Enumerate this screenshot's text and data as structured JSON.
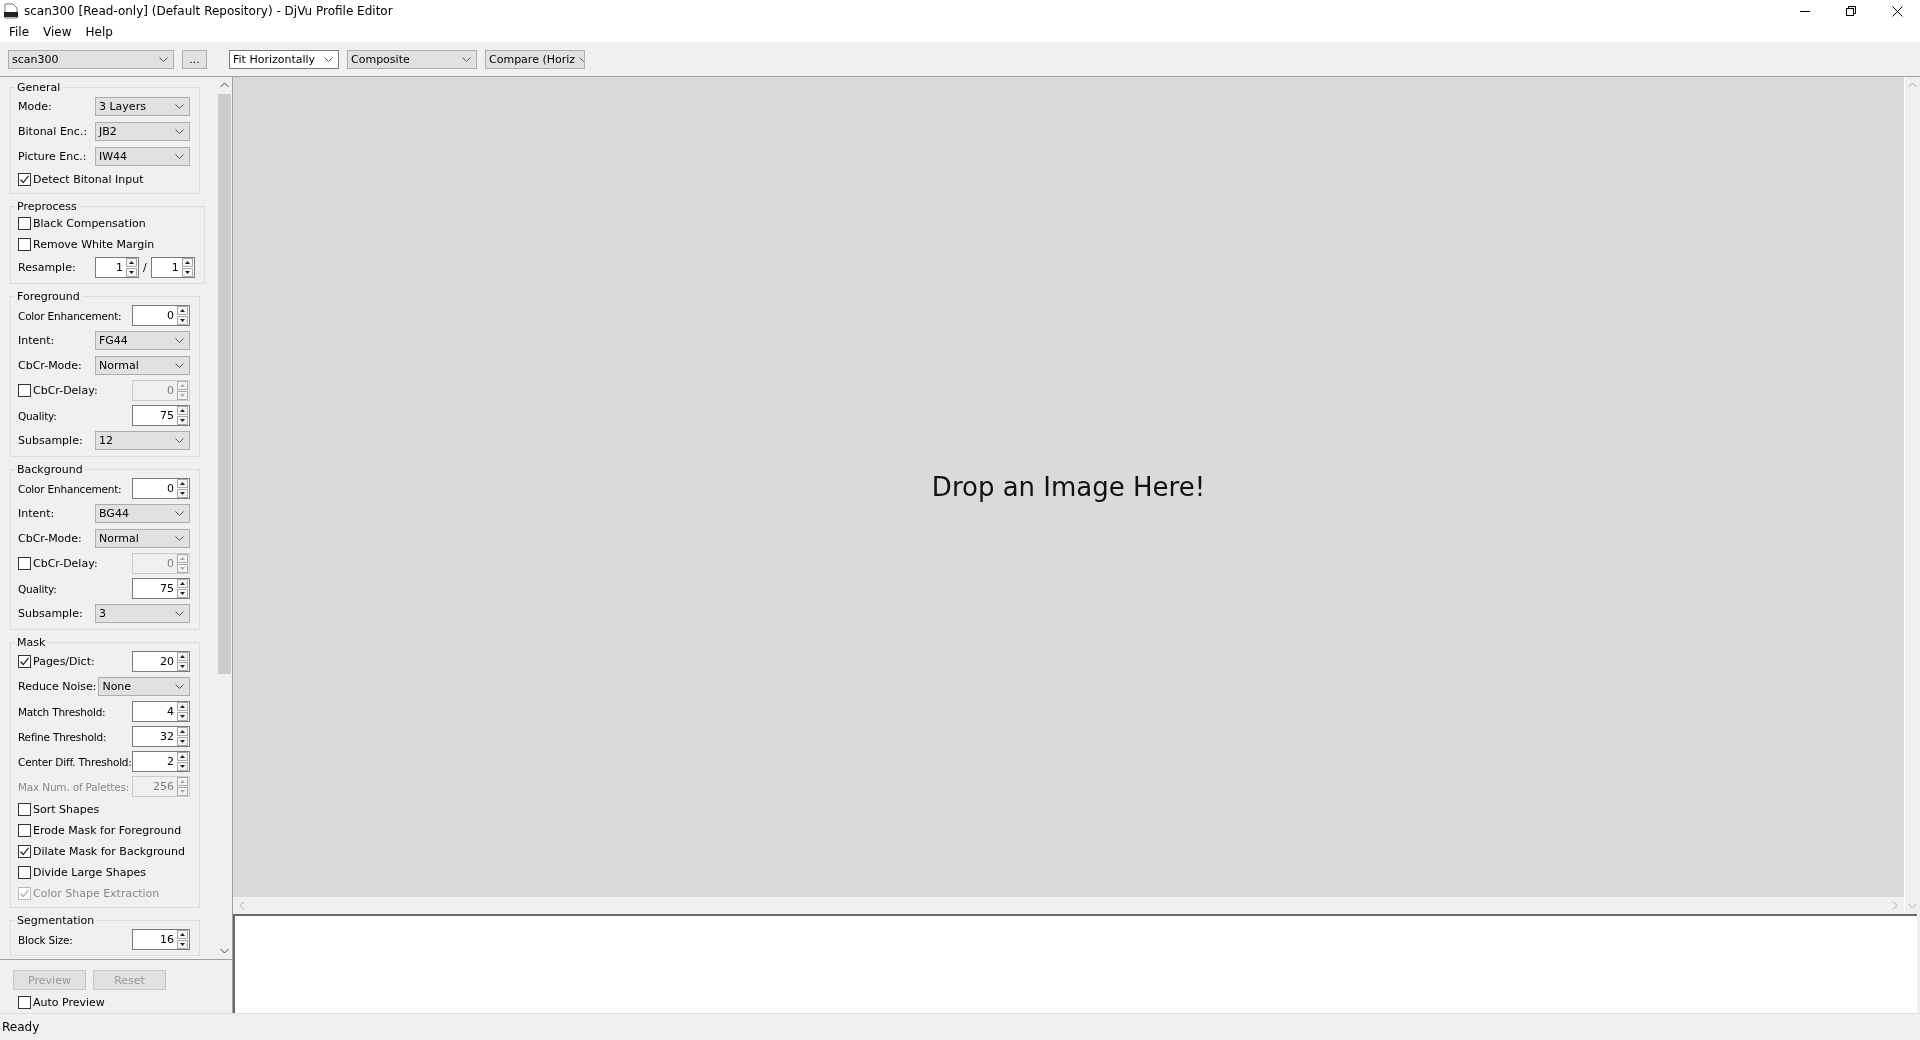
{
  "window": {
    "title": "scan300 [Read-only] (Default Repository) - DjVu Profile Editor"
  },
  "menu": [
    "File",
    "View",
    "Help"
  ],
  "toolbar": {
    "profile": "scan300",
    "browse": "...",
    "zoom": "Fit Horizontally",
    "display": "Composite",
    "compare": "Compare (Horiz"
  },
  "settings": [
    {
      "title": "General",
      "rows": [
        {
          "kind": "select",
          "label": "Mode:",
          "value": "3 Layers"
        },
        {
          "kind": "select",
          "label": "Bitonal Enc.:",
          "value": "JB2"
        },
        {
          "kind": "select",
          "label": "Picture Enc.:",
          "value": "IW44"
        },
        {
          "kind": "check",
          "label": "Detect Bitonal Input",
          "checked": true,
          "disabled": false
        }
      ]
    },
    {
      "title": "Preprocess",
      "rows": [
        {
          "kind": "check",
          "label": "Black Compensation",
          "checked": false,
          "disabled": false
        },
        {
          "kind": "check",
          "label": "Remove White Margin",
          "checked": false,
          "disabled": false
        },
        {
          "kind": "ratio",
          "label": "Resample:",
          "value": "1",
          "value2": "1",
          "separator": "/"
        }
      ]
    },
    {
      "title": "Foreground",
      "rows": [
        {
          "kind": "spin",
          "label": "Color Enhancement:",
          "value": "0",
          "disabled": false
        },
        {
          "kind": "select",
          "label": "Intent:",
          "value": "FG44"
        },
        {
          "kind": "select",
          "label": "CbCr-Mode:",
          "value": "Normal"
        },
        {
          "kind": "checkspin",
          "label": "CbCr-Delay:",
          "checked": false,
          "value": "0",
          "disabled": true
        },
        {
          "kind": "spin",
          "label": "Quality:",
          "value": "75",
          "disabled": false
        },
        {
          "kind": "select",
          "label": "Subsample:",
          "value": "12"
        }
      ]
    },
    {
      "title": "Background",
      "rows": [
        {
          "kind": "spin",
          "label": "Color Enhancement:",
          "value": "0",
          "disabled": false
        },
        {
          "kind": "select",
          "label": "Intent:",
          "value": "BG44"
        },
        {
          "kind": "select",
          "label": "CbCr-Mode:",
          "value": "Normal"
        },
        {
          "kind": "checkspin",
          "label": "CbCr-Delay:",
          "checked": false,
          "value": "0",
          "disabled": true
        },
        {
          "kind": "spin",
          "label": "Quality:",
          "value": "75",
          "disabled": false
        },
        {
          "kind": "select",
          "label": "Subsample:",
          "value": "3"
        }
      ]
    },
    {
      "title": "Mask",
      "rows": [
        {
          "kind": "checkspin",
          "label": "Pages/Dict:",
          "checked": true,
          "value": "20",
          "disabled": false
        },
        {
          "kind": "select",
          "label": "Reduce Noise:",
          "value": "None"
        },
        {
          "kind": "spin",
          "label": "Match Threshold:",
          "value": "4",
          "disabled": false
        },
        {
          "kind": "spin",
          "label": "Refine Threshold:",
          "value": "32",
          "disabled": false
        },
        {
          "kind": "spin",
          "label": "Center Diff. Threshold:",
          "value": "2",
          "disabled": false
        },
        {
          "kind": "spin",
          "label": "Max Num. of Palettes:",
          "value": "256",
          "disabled": true
        },
        {
          "kind": "check",
          "label": "Sort Shapes",
          "checked": false,
          "disabled": false
        },
        {
          "kind": "check",
          "label": "Erode Mask for Foreground",
          "checked": false,
          "disabled": false
        },
        {
          "kind": "check",
          "label": "Dilate Mask for Background",
          "checked": true,
          "disabled": false
        },
        {
          "kind": "check",
          "label": "Divide Large Shapes",
          "checked": false,
          "disabled": false
        },
        {
          "kind": "check",
          "label": "Color Shape Extraction",
          "checked": true,
          "disabled": true
        }
      ]
    },
    {
      "title": "Segmentation",
      "rows": [
        {
          "kind": "spin",
          "label": "Block Size:",
          "value": "16",
          "disabled": false
        }
      ]
    }
  ],
  "buttons": [
    {
      "label": "Preview",
      "disabled": true
    },
    {
      "label": "Reset",
      "disabled": true
    }
  ],
  "auto_preview": {
    "label": "Auto Preview",
    "checked": false
  },
  "canvas": {
    "message": "Drop an Image Here!"
  },
  "status_bar": "Ready"
}
